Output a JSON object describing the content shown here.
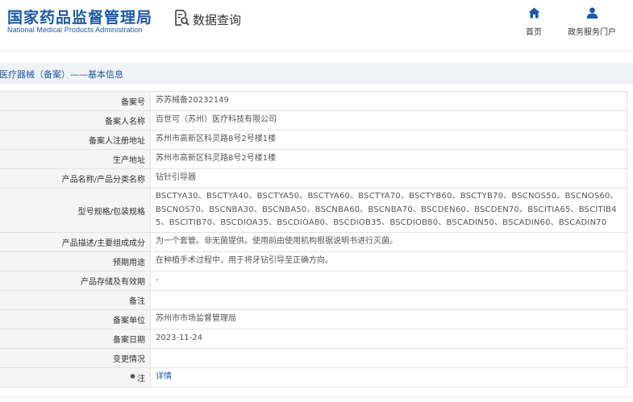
{
  "header": {
    "logo_cn": "国家药品监督管理局",
    "logo_en": "National Medical Products Administration",
    "query_label": "数据查询",
    "query_icon": "document-search-icon",
    "nav": [
      {
        "label": "首页",
        "icon": "home-icon"
      },
      {
        "label": "政务服务门户",
        "icon": "user-icon"
      }
    ]
  },
  "breadcrumb": "医疗器械（备案）——基本信息",
  "record": {
    "rows": [
      {
        "key": "备案号",
        "value": "苏苏械备20232149"
      },
      {
        "key": "备案人名称",
        "value": "百世可（苏州）医疗科技有限公司"
      },
      {
        "key": "备案人注册地址",
        "value": "苏州市高新区科灵路8号2号楼1楼"
      },
      {
        "key": "生产地址",
        "value": "苏州市高新区科灵路8号2号楼1楼"
      },
      {
        "key": "产品名称/产品分类名称",
        "value": "钻针引导器"
      },
      {
        "key": "型号规格/包装规格",
        "value": "BSCTYA30、BSCTYA40、BSCTYA50、BSCTYA60、BSCTYA70、BSCTYB60、BSCTYB70、BSCNOS50、BSCNOS60、BSCNOS70、BSCNBA30、BSCNBA50、BSCNBA60、BSCNBA70、BSCDEN60、BSCDEN70、BSCITIA65、BSCITIB45、BSCITIB70、BSCDIOA35、BSCDIOA80、BSCDIOB35、BSCDIOB80、BSCADIN50、BSCADIN60、BSCADIN70"
      },
      {
        "key": "产品描述/主要组成成分",
        "value": "为一个套管。非无菌提供。使用前由使用机构根据说明书进行灭菌。"
      },
      {
        "key": "预期用途",
        "value": "在种植手术过程中，用于将牙钻引导至正确方向。"
      },
      {
        "key": "产品存储及有效期",
        "value": "-"
      },
      {
        "key": "备注",
        "value": ""
      },
      {
        "key": "备案单位",
        "value": "苏州市市场监督管理局"
      },
      {
        "key": "备案日期",
        "value": "2023-11-24"
      },
      {
        "key": "变更情况",
        "value": ""
      }
    ],
    "note": {
      "key": "注",
      "icon": "bullet-icon",
      "link": "详情"
    }
  }
}
